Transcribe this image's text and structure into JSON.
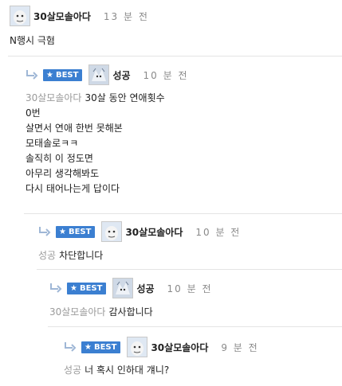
{
  "best_label": "BEST",
  "comments": [
    {
      "name": "30살모솔아다",
      "time": "13 분 전",
      "mention": "",
      "lines": [
        "N행시 극혐"
      ]
    },
    {
      "name": "성공",
      "time": "10 분 전",
      "mention": "30살모솔아다",
      "lines": [
        "30살 동안 연애횟수",
        "0번",
        "살면서 연애 한번 못해본",
        "모태솔로ㅋㅋ",
        "솔직히 이 정도면",
        "아무리 생각해봐도",
        "다시 태어나는게 답이다"
      ]
    },
    {
      "name": "30살모솔아다",
      "time": "10 분 전",
      "mention": "성공",
      "lines": [
        "차단합니다"
      ]
    },
    {
      "name": "성공",
      "time": "10 분 전",
      "mention": "30살모솔아다",
      "lines": [
        "감사합니다"
      ]
    },
    {
      "name": "30살모솔아다",
      "time": "9 분 전",
      "mention": "성공",
      "lines": [
        "너 혹시 인하대 걔니?"
      ]
    }
  ]
}
